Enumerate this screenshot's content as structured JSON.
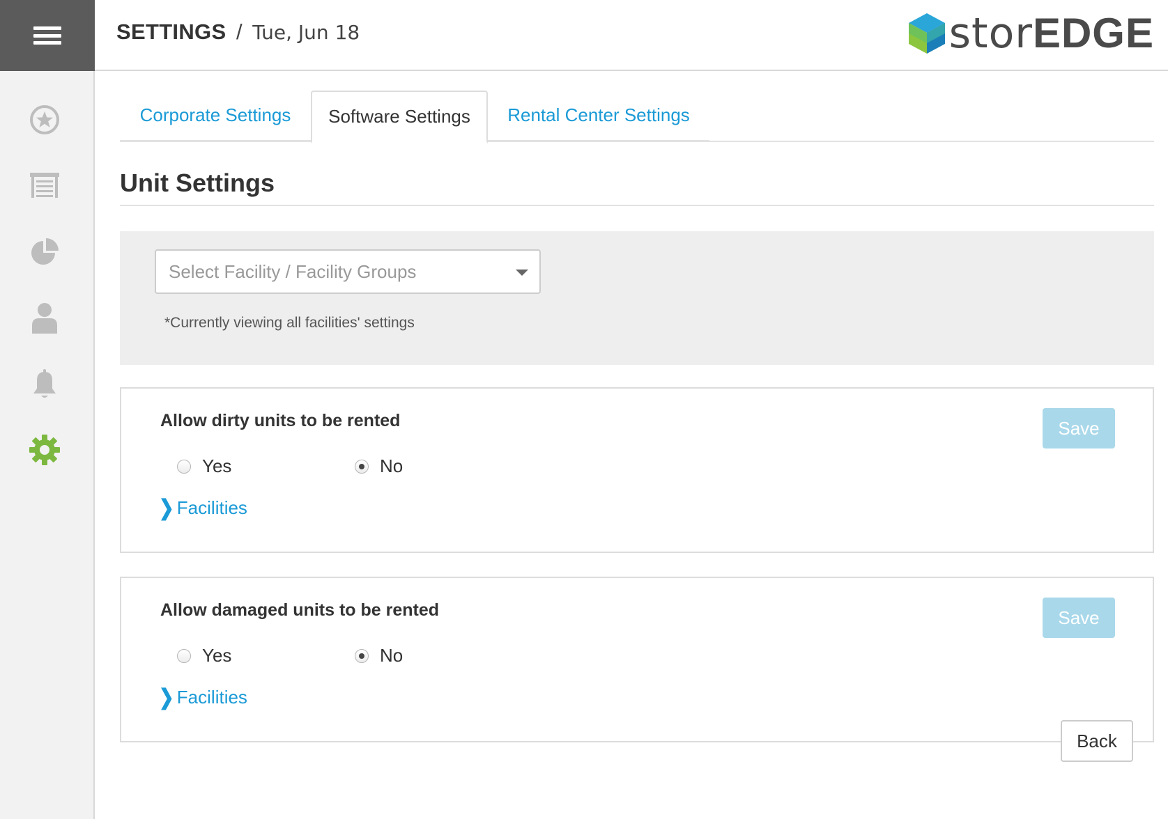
{
  "header": {
    "title": "SETTINGS",
    "separator": "/",
    "date": "Tue, Jun 18",
    "logo": {
      "light": "stor",
      "bold": "EDGE"
    }
  },
  "sidebar": {
    "items": [
      {
        "name": "favorites",
        "icon": "star-circle-icon"
      },
      {
        "name": "units",
        "icon": "storage-unit-icon"
      },
      {
        "name": "reports",
        "icon": "pie-chart-icon"
      },
      {
        "name": "tenants",
        "icon": "person-icon"
      },
      {
        "name": "notifications",
        "icon": "bell-icon"
      },
      {
        "name": "settings",
        "icon": "gear-icon",
        "active": true
      }
    ]
  },
  "tabs": [
    {
      "label": "Corporate Settings",
      "active": false
    },
    {
      "label": "Software Settings",
      "active": true
    },
    {
      "label": "Rental Center Settings",
      "active": false
    }
  ],
  "section": {
    "title": "Unit Settings"
  },
  "filter": {
    "placeholder": "Select Facility / Facility Groups",
    "note": "*Currently viewing all facilities' settings"
  },
  "settings": [
    {
      "title": "Allow dirty units to be rented",
      "save_label": "Save",
      "options": [
        {
          "label": "Yes",
          "checked": false
        },
        {
          "label": "No",
          "checked": true
        }
      ],
      "facilities_label": "Facilities"
    },
    {
      "title": "Allow damaged units to be rented",
      "save_label": "Save",
      "options": [
        {
          "label": "Yes",
          "checked": false
        },
        {
          "label": "No",
          "checked": true
        }
      ],
      "facilities_label": "Facilities"
    }
  ],
  "footer": {
    "back_label": "Back"
  },
  "colors": {
    "link": "#1a9ad6",
    "save_disabled": "#a9d8ea",
    "settings_active": "#7cb83f",
    "sidebar_icon": "#bdbdbd",
    "header_dark": "#5b5b5b"
  }
}
